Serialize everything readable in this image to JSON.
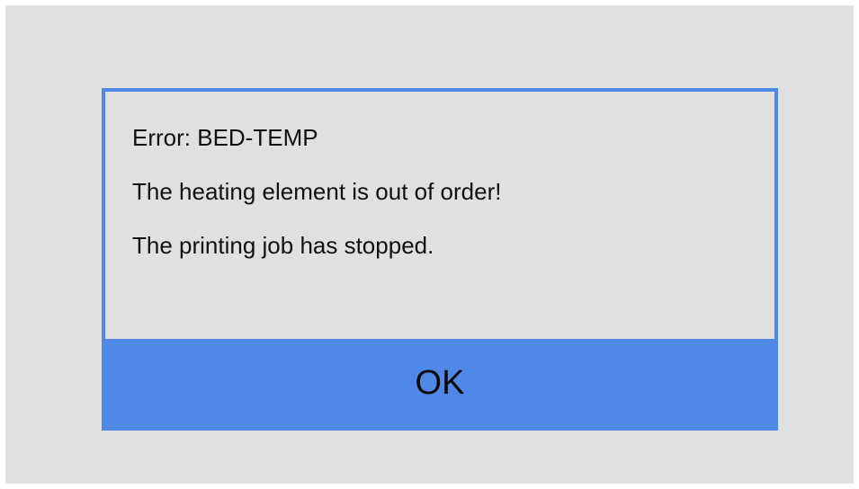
{
  "dialog": {
    "messages": [
      "Error: BED-TEMP",
      "The heating element is out of order!",
      "The printing job has stopped."
    ],
    "ok_label": "OK"
  },
  "colors": {
    "background": "#e0e0e0",
    "accent": "#5088e8",
    "text": "#111111"
  }
}
